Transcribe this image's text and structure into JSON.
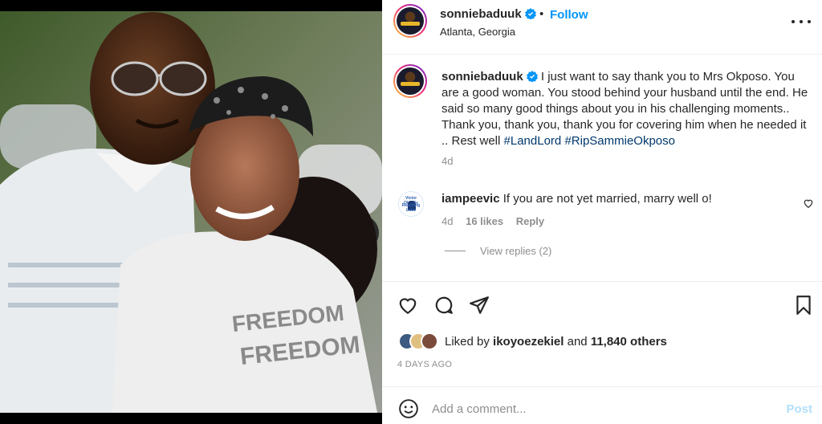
{
  "header": {
    "username": "sonniebaduuk",
    "separator": "•",
    "follow_label": "Follow",
    "location": "Atlanta, Georgia"
  },
  "caption": {
    "username": "sonniebaduuk",
    "text": "I just want to say thank you to Mrs Okposo. You are a good woman. You stood behind your husband until the end. He said so many good things about you in his challenging moments.. Thank you, thank you, thank you for covering him when he needed it .. Rest well",
    "hashtags": [
      "#LandLord",
      "#RipSammieOkposo"
    ],
    "time": "4d"
  },
  "comment": {
    "username": "iampeevic",
    "text": "If you are not yet married, marry well o!",
    "time": "4d",
    "likes": "16 likes",
    "reply_label": "Reply",
    "view_replies": "View replies (2)",
    "avatar_text_top": "Victor Okhai's",
    "avatar_text_bottom": "Reaching Love"
  },
  "likes": {
    "prefix": "Liked by",
    "user": "ikoyoezekiel",
    "and": "and",
    "others": "11,840 others"
  },
  "post_time": "4 DAYS AGO",
  "add_comment": {
    "placeholder": "Add a comment...",
    "post_label": "Post"
  },
  "photo": {
    "shirt_text_1": "FREEDOM",
    "shirt_text_2": "FREEDOM"
  },
  "colors": {
    "link_blue": "#0095f6",
    "hashtag_blue": "#00376b",
    "muted": "#8e8e8e",
    "verified": "#0095f6",
    "post_disabled": "#b2dffc"
  }
}
